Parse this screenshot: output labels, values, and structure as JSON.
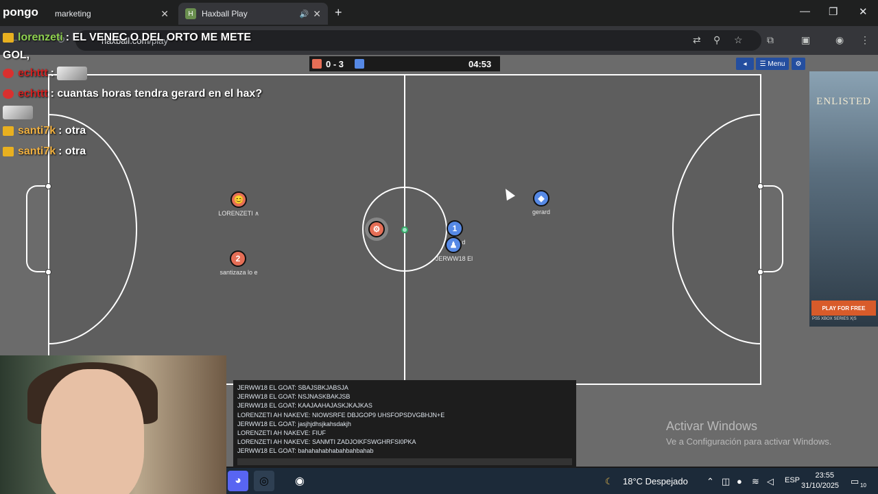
{
  "browser": {
    "tabs": [
      {
        "title": "marketing"
      },
      {
        "title": "Haxball Play"
      }
    ],
    "url_host": "haxball.com",
    "url_path": "/play",
    "tab_favicon_letter": "H"
  },
  "stream": {
    "brand": "pongo",
    "chat": [
      {
        "user": "lorenzeti",
        "text": ": EL VENEC O DEL ORTO ME METE",
        "badge": "crown"
      },
      {
        "user": "",
        "text": "GOL,",
        "badge": ""
      },
      {
        "user": "echttt",
        "text": ":",
        "badge": "red",
        "emote": true
      },
      {
        "user": "echttt",
        "text": ": cuantas horas tendra gerard en el hax?",
        "badge": "red"
      },
      {
        "user": "",
        "text": "",
        "badge": "",
        "emote": true
      },
      {
        "user": "santi7k",
        "text": ": otra",
        "badge": "crown"
      },
      {
        "user": "santi7k",
        "text": ": otra",
        "badge": "crown"
      }
    ]
  },
  "game": {
    "score": "0 - 3",
    "time": "04:53",
    "menu_label": "Menu",
    "colors": {
      "red": "#e56e56",
      "blue": "#5689e5"
    },
    "players": [
      {
        "label": "😊",
        "name": "LORENZETI ∧",
        "team": "red"
      },
      {
        "label": "2",
        "name": "santizaza lo e",
        "team": "red"
      },
      {
        "label": "⚙",
        "name": "",
        "team": "red"
      },
      {
        "label": "1",
        "name": "d",
        "team": "blue"
      },
      {
        "label": "♟",
        "name": "JERWW18 El",
        "team": "blue"
      },
      {
        "label": "◆",
        "name": "gerard",
        "team": "blue"
      }
    ],
    "chat_messages": [
      "JERWW18 EL GOAT: SBAJSBKJABSJA",
      "JERWW18 EL GOAT: NSJNASKBAKJSB",
      "JERWW18 EL GOAT: KAAJAAHAJASKJKAJKAS",
      "LORENZETI AH NAKEVE: NIOWSRFE DBJGOP9 UHSFOPSDVGBHJN+E",
      "JERWW18 EL GOAT: jasjhjdhsjkahsdakjh",
      "LORENZETI AH NAKEVE: FIUF",
      "LORENZETI AH NAKEVE: SANMTI ZADJOIKFSWGHRFSI0PKA",
      "JERWW18 EL GOAT: bahahahabhabahbahbahab"
    ]
  },
  "ad": {
    "logo": "ENLISTED",
    "cta": "PLAY FOR FREE",
    "platforms": "PS5  XBOX SERIES X|S"
  },
  "windows": {
    "activate_title": "Activar Windows",
    "activate_sub": "Ve a Configuración para activar Windows.",
    "weather": "18°C  Despejado",
    "lang": "ESP",
    "time": "23:55",
    "date": "31/10/2025",
    "notif_count": "10"
  }
}
